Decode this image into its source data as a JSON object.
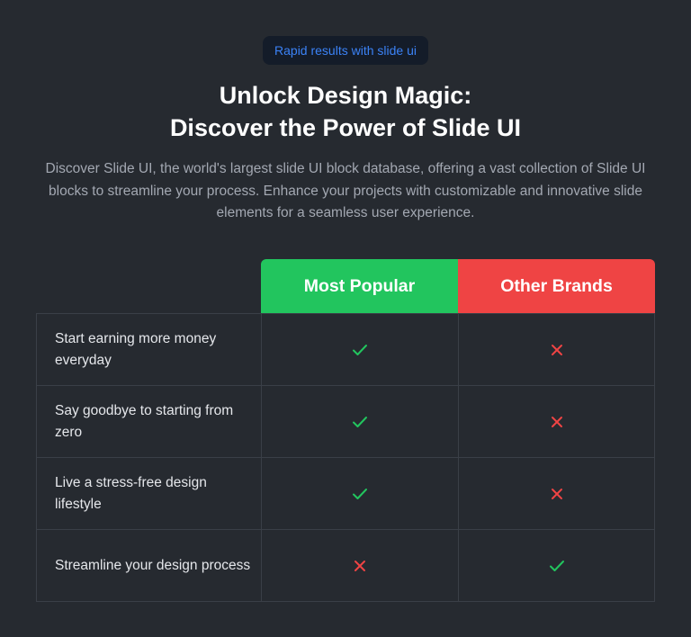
{
  "badge": {
    "label": "Rapid results with slide ui"
  },
  "hero": {
    "title_line1": "Unlock Design Magic:",
    "title_line2": "Discover the Power of Slide UI",
    "description": "Discover Slide UI, the world's largest slide UI block database, offering a vast collection of Slide UI blocks to streamline your process. Enhance your projects with customizable and innovative slide elements for a seamless user experience."
  },
  "comparison": {
    "columns": [
      {
        "label": "Most Popular",
        "color": "#22c55e"
      },
      {
        "label": "Other Brands",
        "color": "#ef4444"
      }
    ],
    "rows": [
      {
        "feature": "Start earning more money everyday",
        "popular": "check-icon",
        "other": "cross-icon"
      },
      {
        "feature": "Say goodbye to starting from zero",
        "popular": "check-icon",
        "other": "cross-icon"
      },
      {
        "feature": "Live a stress-free design lifestyle",
        "popular": "check-icon",
        "other": "cross-icon"
      },
      {
        "feature": "Streamline your design process",
        "popular": "cross-icon",
        "other": "check-icon"
      }
    ]
  },
  "colors": {
    "background": "#262a30",
    "check": "#22c55e",
    "cross": "#ef4444",
    "badge_text": "#3b82f6"
  }
}
